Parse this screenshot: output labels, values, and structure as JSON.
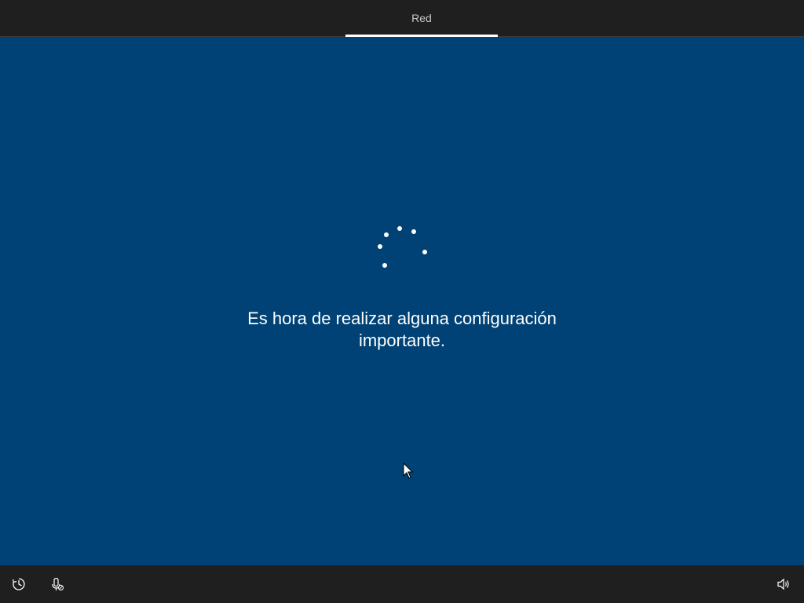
{
  "window": {
    "background_color": "#004275",
    "bar_color": "#1f1f1f"
  },
  "header": {
    "steps": [
      {
        "label": "Red",
        "active": true
      }
    ]
  },
  "main": {
    "spinner_icon": "loading-dots-icon",
    "message": "Es hora de realizar alguna configuración importante."
  },
  "footer": {
    "left_icons": [
      "accessibility-icon",
      "microphone-muted-icon"
    ],
    "right_icons": [
      "volume-icon"
    ]
  }
}
